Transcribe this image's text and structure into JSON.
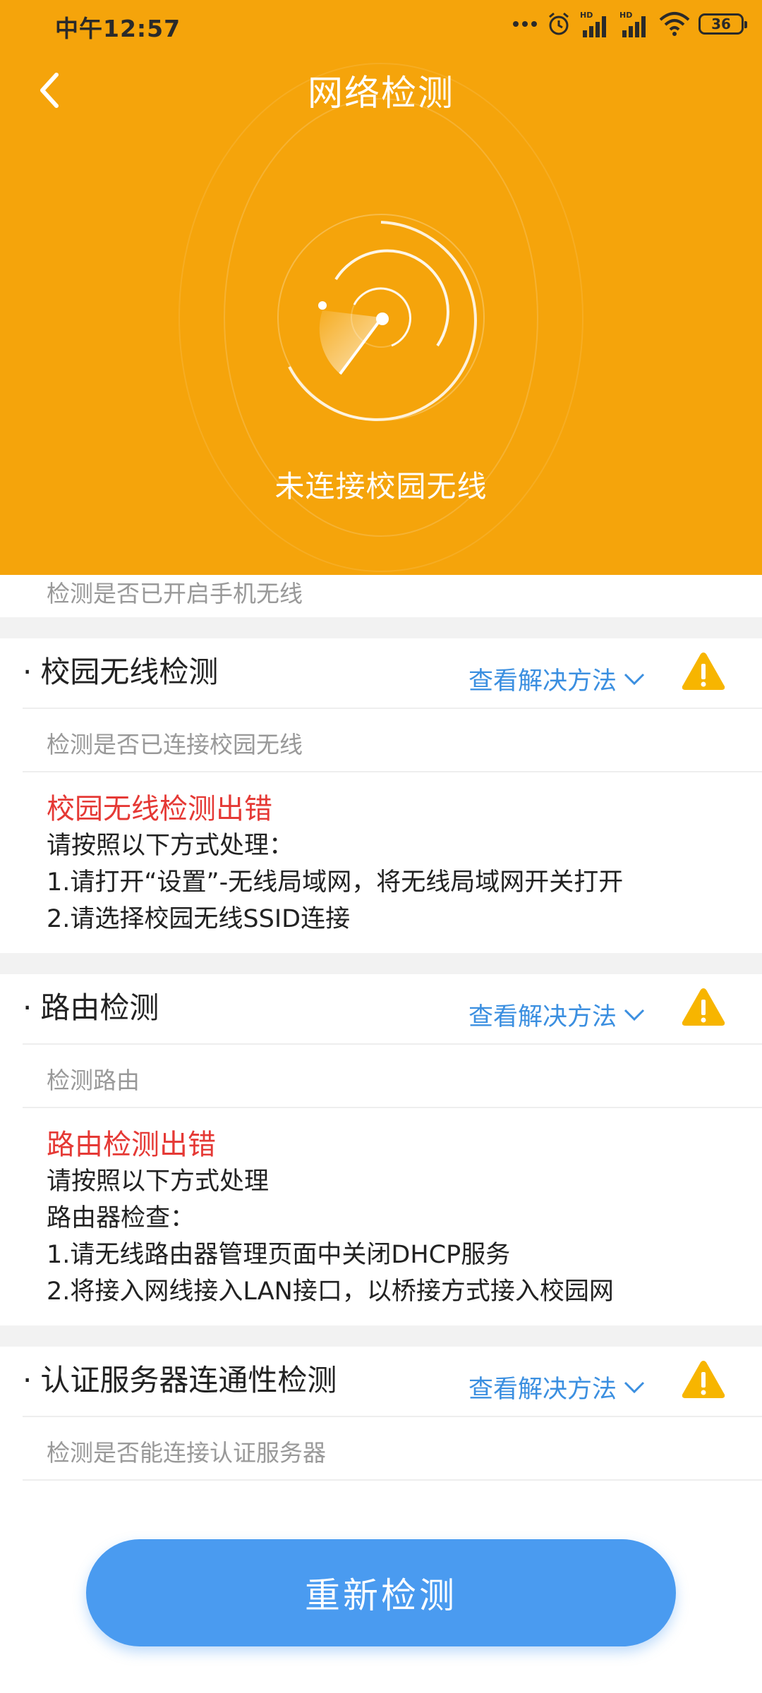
{
  "status_bar": {
    "time": "中午12:57",
    "battery": "36",
    "hd1": "HD",
    "hd2": "HD",
    "icons": [
      "more-dots-icon",
      "alarm-icon",
      "signal-hd-icon",
      "signal-hd-icon",
      "wifi-icon",
      "battery-icon"
    ]
  },
  "header": {
    "title": "网络检测",
    "back_icon": "back-chevron-icon",
    "radar_status": "未连接校园无线",
    "background_color": "#F5A40B"
  },
  "partial_item": {
    "description": "检测是否已开启手机无线"
  },
  "sections": [
    {
      "title": "校园无线检测",
      "link": "查看解决方法",
      "description": "检测是否已连接校园无线",
      "status_icon": "warning-icon",
      "error": {
        "title": "校园无线检测出错",
        "lines": [
          "请按照以下方式处理：",
          "1.请打开“设置”-无线局域网，将无线局域网开关打开",
          "2.请选择校园无线SSID连接"
        ]
      }
    },
    {
      "title": "路由检测",
      "link": "查看解决方法",
      "description": "检测路由",
      "status_icon": "warning-icon",
      "error": {
        "title": "路由检测出错",
        "lines": [
          "请按照以下方式处理",
          "路由器检查：",
          "1.请无线路由器管理页面中关闭DHCP服务",
          "2.将接入网线接入LAN接口，以桥接方式接入校园网"
        ]
      }
    },
    {
      "title": "认证服务器连通性检测",
      "link": "查看解决方法",
      "description": "检测是否能连接认证服务器",
      "status_icon": "warning-icon"
    }
  ],
  "bottom": {
    "recheck_label": "重新检测",
    "button_color": "#4A9BF0"
  },
  "colors": {
    "accent_orange": "#F5A40B",
    "link_blue": "#3b8fe0",
    "error_red": "#e53935",
    "warning_yellow": "#F7B500"
  }
}
